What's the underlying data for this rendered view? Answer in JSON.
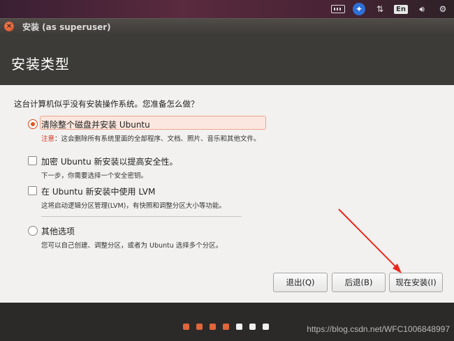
{
  "tray": {
    "language": "En",
    "icons": [
      "keyboard-icon",
      "accessibility-icon",
      "network-icon",
      "language-indicator",
      "volume-icon",
      "settings-gear-icon"
    ]
  },
  "window": {
    "title": "安装 (as superuser)",
    "close_glyph": "×"
  },
  "header": {
    "title": "安装类型"
  },
  "main": {
    "question": "这台计算机似乎没有安装操作系统。您准备怎么做？",
    "options": [
      {
        "type": "radio",
        "checked": true,
        "label": "清除整个磁盘并安装 Ubuntu",
        "warn_prefix": "注意",
        "desc": "：这会删除所有系统里面的全部程序、文档、照片、音乐和其他文件。"
      },
      {
        "type": "checkbox",
        "checked": false,
        "label": "加密 Ubuntu 新安装以提高安全性。",
        "desc": "下一步，你需要选择一个安全密钥。"
      },
      {
        "type": "checkbox",
        "checked": false,
        "label": "在 Ubuntu 新安装中使用 LVM",
        "desc": "这将启动逻辑分区管理(LVM)，有快照和调整分区大小等功能。"
      },
      {
        "type": "radio",
        "checked": false,
        "label": "其他选项",
        "desc": "您可以自己创建、调整分区，或者为 Ubuntu 选择多个分区。"
      }
    ]
  },
  "buttons": {
    "quit": "退出(Q)",
    "back": "后退(B)",
    "install": "现在安装(I)"
  },
  "progress": {
    "steps_done": 4,
    "steps_total": 7,
    "active_color": "#e0663c",
    "inactive_color": "#f0f0f0"
  },
  "annotation_color": "#e8281c",
  "watermark": "https://blog.csdn.net/WFC1006848997"
}
